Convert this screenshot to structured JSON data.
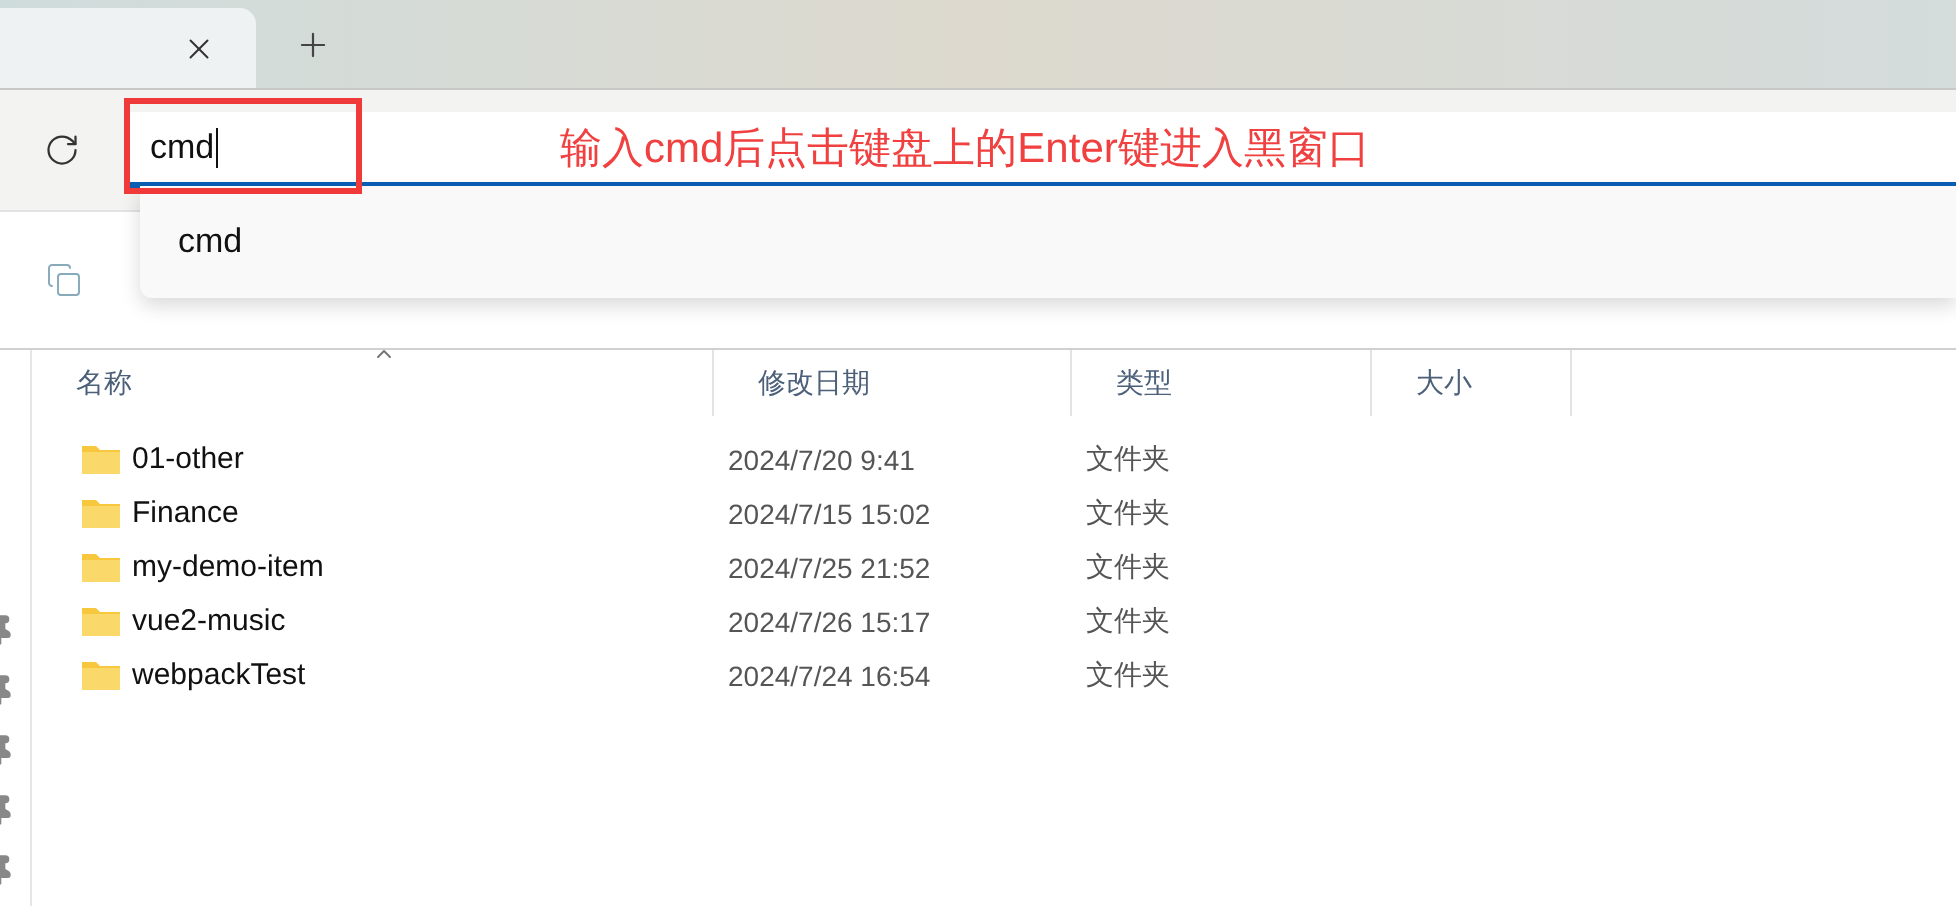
{
  "tabs": [
    {
      "selected": true
    }
  ],
  "address_bar": {
    "value": "cmd",
    "focused": true
  },
  "suggestions": [
    {
      "label": "cmd"
    }
  ],
  "annotation": {
    "text": "输入cmd后点击键盘上的Enter键进入黑窗口"
  },
  "columns": [
    {
      "label": "名称",
      "sorted": true
    },
    {
      "label": "修改日期",
      "sorted": false
    },
    {
      "label": "类型",
      "sorted": false
    },
    {
      "label": "大小",
      "sorted": false
    }
  ],
  "rows": [
    {
      "kind": "folder",
      "name": "01-other",
      "modified": "2024/7/20 9:41",
      "type": "文件夹"
    },
    {
      "kind": "folder",
      "name": "Finance",
      "modified": "2024/7/15 15:02",
      "type": "文件夹"
    },
    {
      "kind": "folder",
      "name": "my-demo-item",
      "modified": "2024/7/25 21:52",
      "type": "文件夹"
    },
    {
      "kind": "folder",
      "name": "vue2-music",
      "modified": "2024/7/26 15:17",
      "type": "文件夹"
    },
    {
      "kind": "folder",
      "name": "webpackTest",
      "modified": "2024/7/24 16:54",
      "type": "文件夹"
    }
  ]
}
